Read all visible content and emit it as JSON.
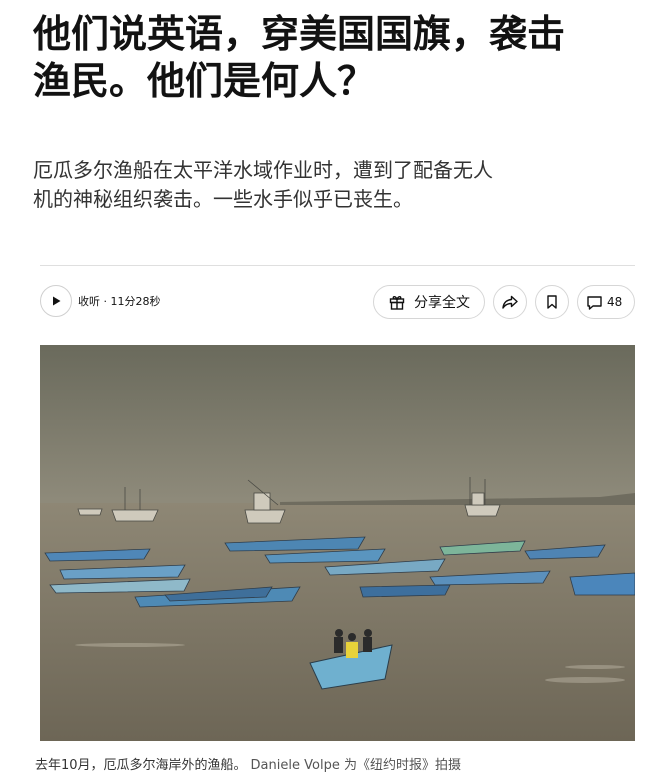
{
  "article": {
    "headline_line1": "他们说英语，穿美国国旗，袭击",
    "headline_line2": "渔民。他们是何人？",
    "summary_line1": "厄瓜多尔渔船在太平洋水域作业时，遭到了配备无人",
    "summary_line2": "机的神秘组织袭击。一些水手似乎已丧生。"
  },
  "toolbar": {
    "listen_label": "收听 · 11分28秒",
    "share_label": "分享全文",
    "comments_count": "48"
  },
  "photo": {
    "caption": "去年10月，厄瓜多尔海岸外的渔船。",
    "credit": "Daniele Volpe 为《纽约时报》拍摄"
  },
  "icons": {
    "play": "play-icon",
    "gift": "gift-icon",
    "share": "share-arrow-icon",
    "bookmark": "bookmark-icon",
    "comment": "comment-icon"
  }
}
